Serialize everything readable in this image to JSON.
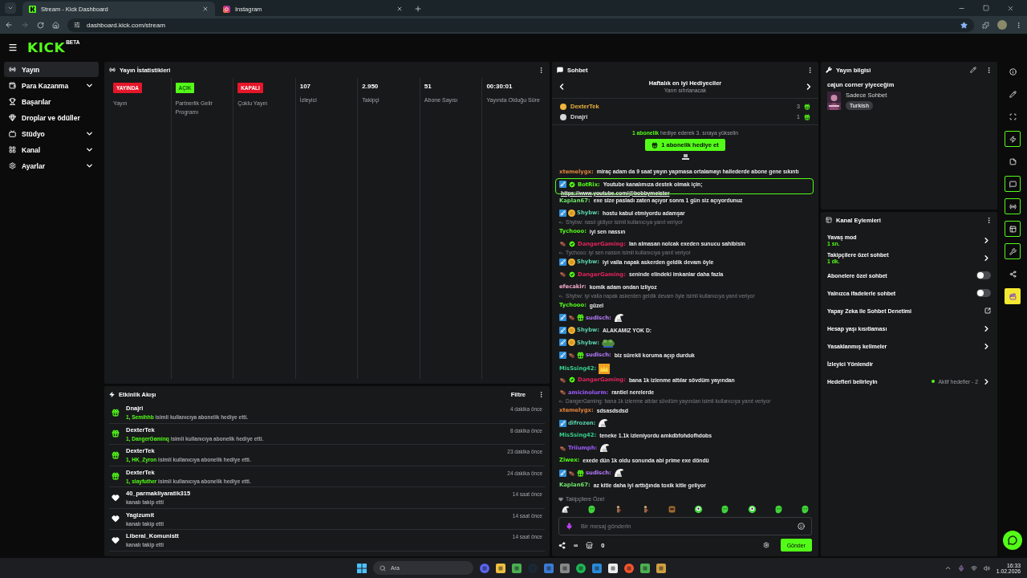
{
  "browser": {
    "tabs": [
      {
        "title": "Stream - Kick Dashboard",
        "kind": "kick",
        "selected": true
      },
      {
        "title": "Instagram",
        "kind": "instagram",
        "selected": false
      }
    ],
    "url": "dashboard.kick.com/stream"
  },
  "header": {
    "logo": "KICK",
    "logo_tag": "BETA"
  },
  "sidebar": {
    "items": [
      {
        "label": "Yayın",
        "selected": true
      },
      {
        "label": "Para Kazanma",
        "selected": false,
        "expanded": false
      },
      {
        "label": "Başarılar",
        "selected": false
      },
      {
        "label": "Droplar ve ödüller",
        "selected": false
      },
      {
        "label": "Stüdyo",
        "selected": false,
        "expanded": false
      },
      {
        "label": "Kanal",
        "selected": false,
        "expanded": false
      },
      {
        "label": "Ayarlar",
        "selected": false,
        "expanded": false
      }
    ]
  },
  "stats": {
    "title": "Yayın İstatistikleri",
    "items": [
      {
        "kind": "tag",
        "value": "YAYINDA",
        "color": "#e5162a",
        "label": "Yayın"
      },
      {
        "kind": "tag",
        "value": "AÇIK",
        "color": "#53fc18",
        "label": "Partnerlik Gelir Programı"
      },
      {
        "kind": "tag",
        "value": "KAPALI",
        "color": "#e5162a",
        "label": "Çoklu Yayın"
      },
      {
        "kind": "number",
        "value": "107",
        "label": "İzleyici"
      },
      {
        "kind": "number",
        "value": "2.950",
        "label": "Takipçi"
      },
      {
        "kind": "number",
        "value": "51",
        "label": "Abone Sayısı"
      },
      {
        "kind": "number",
        "value": "00:30:01",
        "label": "Yayında Olduğu Süre"
      }
    ]
  },
  "activity": {
    "title": "Etkinlik Akışı",
    "filter": "Filtre",
    "items": [
      {
        "kind": "gift",
        "user": "Dnajri",
        "recipient": "1, Semihhb",
        "text": "isimli kullanıcıya abonelik hediye etti.",
        "time": "4 dakika önce"
      },
      {
        "kind": "gift",
        "user": "DexterTek",
        "recipient": "1, DangerGaminq",
        "text": "isimli kullanıcıya abonelik hediye etti.",
        "time": "8 dakika önce"
      },
      {
        "kind": "gift",
        "user": "DexterTek",
        "recipient": "1, HK_Zyron",
        "text": "isimli kullanıcıya abonelik hediye etti.",
        "time": "23 dakika önce"
      },
      {
        "kind": "gift",
        "user": "DexterTek",
        "recipient": "1, slayfuther",
        "text": "isimli kullanıcıya abonelik hediye etti.",
        "time": "24 dakika önce"
      },
      {
        "kind": "follow",
        "user": "40_parmakliyaratik315",
        "text": "kanalı takip etti",
        "time": "14 saat önce"
      },
      {
        "kind": "follow",
        "user": "Yagizumit",
        "text": "kanalı takip etti",
        "time": "14 saat önce"
      },
      {
        "kind": "follow",
        "user": "Liberal_Komunistt",
        "text": "kanalı takip etti",
        "time": "14 saat önce"
      }
    ]
  },
  "chat": {
    "title": "Sohbet",
    "leaderboard": {
      "title": "Haftalık en iyi Hediyeciler",
      "subtitle": "Yarın sıfırlanacak",
      "gifters": [
        {
          "name": "DexterTek",
          "count": "3",
          "color": "#f0b43c"
        },
        {
          "name": "Dnajri",
          "count": "1",
          "color": "#d8d8d8"
        }
      ]
    },
    "promo": {
      "highlight": "1 abonelik",
      "text": "hediye ederek 3. sıraya yükselin",
      "button": "1 abonelik hediye et"
    },
    "messages": [
      {
        "kind": "message",
        "user": "xtemelygx:",
        "color": "#e0823a",
        "text": "miraç adam da 9 saat yayın yapmasa ortalamayı hallederde abone gene sıkıntı"
      },
      {
        "kind": "message",
        "user": "BotRix:",
        "color": "#53fc18",
        "badges": [
          {
            "kind": "mod"
          },
          {
            "kind": "verified"
          }
        ],
        "text": "Youtube kanalımıza destek olmak için;",
        "link": "https://www.youtube.com/@bobbymeister",
        "highlighted": true
      },
      {
        "kind": "message",
        "user": "Kaplan67:",
        "color": "#6fe36a",
        "text": "exe size pasladı zaten açıyor sonra 1 gün siz açıyordunuz"
      },
      {
        "kind": "message",
        "user": "Shybw:",
        "color": "#5ad2a8",
        "badges": [
          {
            "kind": "mod"
          },
          {
            "kind": "founder"
          }
        ],
        "text": "hostu kabul etmiyordu adamşar"
      },
      {
        "kind": "reply",
        "text": "Shybw: nasıl gidiyor isimli kullanıcıya yanıt veriyor"
      },
      {
        "kind": "message",
        "user": "Tychooo:",
        "color": "#53fc18",
        "text": "iyi sen nassın"
      },
      {
        "kind": "message",
        "user": "DangerGaming:",
        "color": "#e0245e",
        "badges": [
          {
            "kind": "sub"
          },
          {
            "kind": "verified"
          }
        ],
        "text": "lan almasan nolcak exeden sunucu sahibisin"
      },
      {
        "kind": "reply",
        "text": "Tychooo: iyi sen nassın isimli kullanıcıya yanıt veriyor"
      },
      {
        "kind": "message",
        "user": "Shybw:",
        "color": "#5ad2a8",
        "badges": [
          {
            "kind": "mod"
          },
          {
            "kind": "founder"
          }
        ],
        "text": "iyi valla napak askerden geldik devam öyle"
      },
      {
        "kind": "message",
        "user": "DangerGaming:",
        "color": "#e0245e",
        "badges": [
          {
            "kind": "sub"
          },
          {
            "kind": "verified"
          }
        ],
        "text": "seninde elindeki imkanlar daha fazla"
      },
      {
        "kind": "message",
        "user": "efecakir:",
        "color": "#f0a8c8",
        "text": "komik adam ondan izliyoz"
      },
      {
        "kind": "reply",
        "text": "Shybw: iyi valla napak askerden geldik devam öyle isimli kullanıcıya yanıt veriyor"
      },
      {
        "kind": "message",
        "user": "Tychooo:",
        "color": "#53fc18",
        "text": "güzel"
      },
      {
        "kind": "message",
        "user": "sudisch:",
        "color": "#b57bff",
        "badges": [
          {
            "kind": "mod"
          },
          {
            "kind": "sub"
          },
          {
            "kind": "gift"
          }
        ],
        "emote": {
          "kind": "helmet"
        }
      },
      {
        "kind": "message",
        "user": "Shybw:",
        "color": "#5ad2a8",
        "badges": [
          {
            "kind": "mod"
          },
          {
            "kind": "founder"
          }
        ],
        "text": "ALAKAMIZ YOK D:"
      },
      {
        "kind": "message",
        "user": "Shybw:",
        "color": "#5ad2a8",
        "badges": [
          {
            "kind": "mod"
          },
          {
            "kind": "founder"
          }
        ],
        "emote": {
          "kind": "frog"
        }
      },
      {
        "kind": "message",
        "user": "sudisch:",
        "color": "#b57bff",
        "badges": [
          {
            "kind": "mod"
          },
          {
            "kind": "sub"
          },
          {
            "kind": "gift"
          }
        ],
        "text": "biz sürekli koruma açıp durduk"
      },
      {
        "kind": "message",
        "user": "MisSsing42:",
        "color": "#35d08a",
        "emote": {
          "kind": "crown"
        }
      },
      {
        "kind": "message",
        "user": "DangerGaming:",
        "color": "#e0245e",
        "badges": [
          {
            "kind": "sub"
          },
          {
            "kind": "verified"
          }
        ],
        "text": "bana 1k izlenme attılar sövdüm yayından"
      },
      {
        "kind": "message",
        "user": "amicinolurm:",
        "color": "#9b5cff",
        "badges": [
          {
            "kind": "sub"
          }
        ],
        "text": "rantiel nerelerde"
      },
      {
        "kind": "reply",
        "text": "DangerGaming: bana 1k izlenme attılar sövdüm yayından isimli kullanıcıya yanıt veriyor"
      },
      {
        "kind": "message",
        "user": "xtemelygx:",
        "color": "#e0823a",
        "text": "sdsasdsdsd"
      },
      {
        "kind": "message",
        "user": "difrozen:",
        "color": "#5ad2a8",
        "badges": [
          {
            "kind": "mod"
          }
        ],
        "emote": {
          "kind": "helmet"
        }
      },
      {
        "kind": "message",
        "user": "MisSsing42:",
        "color": "#35d08a",
        "text": "teneke 1.1k izleniyordu amkdbfohdofhdobs"
      },
      {
        "kind": "message",
        "user": "Triiumph:",
        "color": "#9b5cff",
        "badges": [
          {
            "kind": "sub"
          }
        ],
        "emote": {
          "kind": "helmet"
        }
      },
      {
        "kind": "message",
        "user": "Ziwex:",
        "color": "#53fc18",
        "text": "exede dün 1k oldu sonunda abi prime exe döndü"
      },
      {
        "kind": "message",
        "user": "sudisch:",
        "color": "#b57bff",
        "badges": [
          {
            "kind": "mod"
          },
          {
            "kind": "sub"
          },
          {
            "kind": "gift"
          }
        ],
        "emote": {
          "kind": "helmet"
        }
      },
      {
        "kind": "message",
        "user": "Kaplan67:",
        "color": "#6fe36a",
        "text": "az kitle daha iyi arttığında toxik kitle geliyor"
      }
    ],
    "emote_bar": {
      "label": "Takipçilere Özel",
      "emotes": [
        {
          "kind": "helmet"
        },
        {
          "kind": "blob"
        },
        {
          "kind": "figure"
        },
        {
          "kind": "figure"
        },
        {
          "kind": "box"
        },
        {
          "kind": "face"
        },
        {
          "kind": "blob"
        },
        {
          "kind": "face"
        },
        {
          "kind": "blob"
        },
        {
          "kind": "blob"
        }
      ]
    },
    "input": {
      "placeholder": "Bir mesaj gönderin"
    },
    "footer": {
      "points": "∞",
      "store": "0",
      "send": "Gönder"
    }
  },
  "stream_info": {
    "title": "Yayın bilgisi",
    "stream_title": "cajun corner yiyeceğim",
    "category": "Sadece Sohbet",
    "tag": "Turkish"
  },
  "channel_actions": {
    "title": "Kanal Eylemleri",
    "items": [
      {
        "kind": "link",
        "label": "Yavaş mod",
        "value": "1 sn."
      },
      {
        "kind": "link",
        "label": "Takipçilere özel sohbet",
        "value": "1 dk."
      },
      {
        "kind": "toggle",
        "label": "Abonelere özel sohbet",
        "on": false
      },
      {
        "kind": "toggle",
        "label": "Yalnızca ifadelerle sohbet",
        "on": false
      },
      {
        "kind": "external",
        "label": "Yapay Zeka ile Sohbet Denetimi"
      },
      {
        "kind": "link",
        "label": "Hesap yaşı kısıtlaması"
      },
      {
        "kind": "link",
        "label": "Yasaklanmış kelimeler"
      },
      {
        "kind": "plain",
        "label": "İzleyici Yönlendir"
      },
      {
        "kind": "goal",
        "label": "Hedefleri belirleyin",
        "status": "Aktif hedefler - 2"
      }
    ]
  },
  "rail": [
    {
      "kind": "info",
      "active": false
    },
    {
      "kind": "edit",
      "active": false
    },
    {
      "kind": "focus",
      "active": false
    },
    {
      "kind": "bolt",
      "active": true
    },
    {
      "kind": "note",
      "active": false
    },
    {
      "kind": "chat",
      "active": true
    },
    {
      "kind": "signal",
      "active": true
    },
    {
      "kind": "layout",
      "active": true
    },
    {
      "kind": "wrench",
      "active": true
    },
    {
      "kind": "share",
      "active": false
    },
    {
      "kind": "clapper",
      "active": false
    }
  ],
  "taskbar": {
    "search": "Ara",
    "time": "16:33",
    "date": "1.02.2026"
  }
}
